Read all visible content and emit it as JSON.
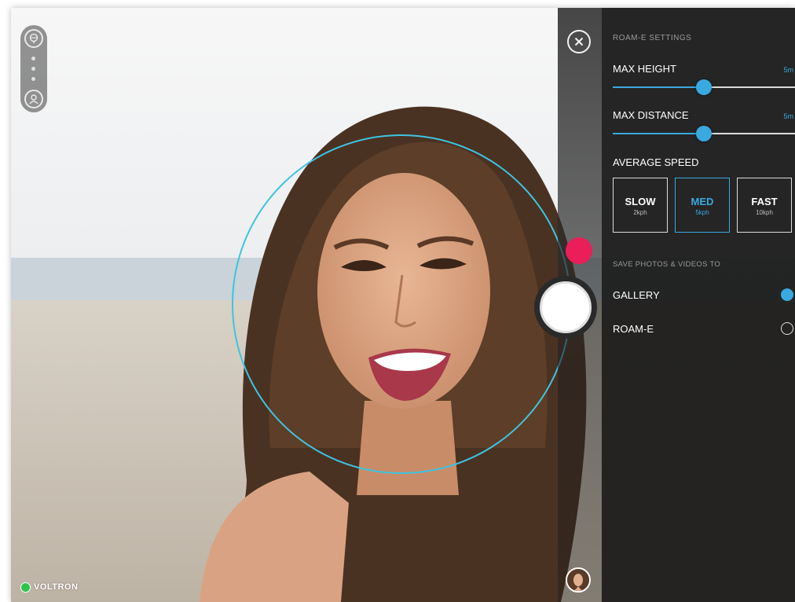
{
  "app": {
    "brand_name": "VOLTRON",
    "brand_status_color": "#2ec44c"
  },
  "toolbar": {
    "top_icon": "eye-icon",
    "bottom_icon": "person-icon"
  },
  "camera": {
    "close_icon": "close-icon",
    "record_color": "#ea1e58",
    "face_tracking_color": "#3fc3e0"
  },
  "settings": {
    "title": "ROAM-E SETTINGS",
    "max_height": {
      "label": "MAX HEIGHT",
      "value": "5m",
      "level": 0.5
    },
    "max_distance": {
      "label": "MAX DISTANCE",
      "value": "5m",
      "level": 0.5
    },
    "average_speed": {
      "label": "AVERAGE SPEED",
      "options": [
        {
          "name": "SLOW",
          "speed": "2kph",
          "selected": false
        },
        {
          "name": "MED",
          "speed": "5kph",
          "selected": true
        },
        {
          "name": "FAST",
          "speed": "10kph",
          "selected": false
        }
      ]
    },
    "save_to": {
      "label": "SAVE PHOTOS & VIDEOS TO",
      "options": [
        {
          "name": "GALLERY",
          "selected": true
        },
        {
          "name": "ROAM-E",
          "selected": false
        }
      ]
    },
    "accent_color": "#39a9df"
  }
}
